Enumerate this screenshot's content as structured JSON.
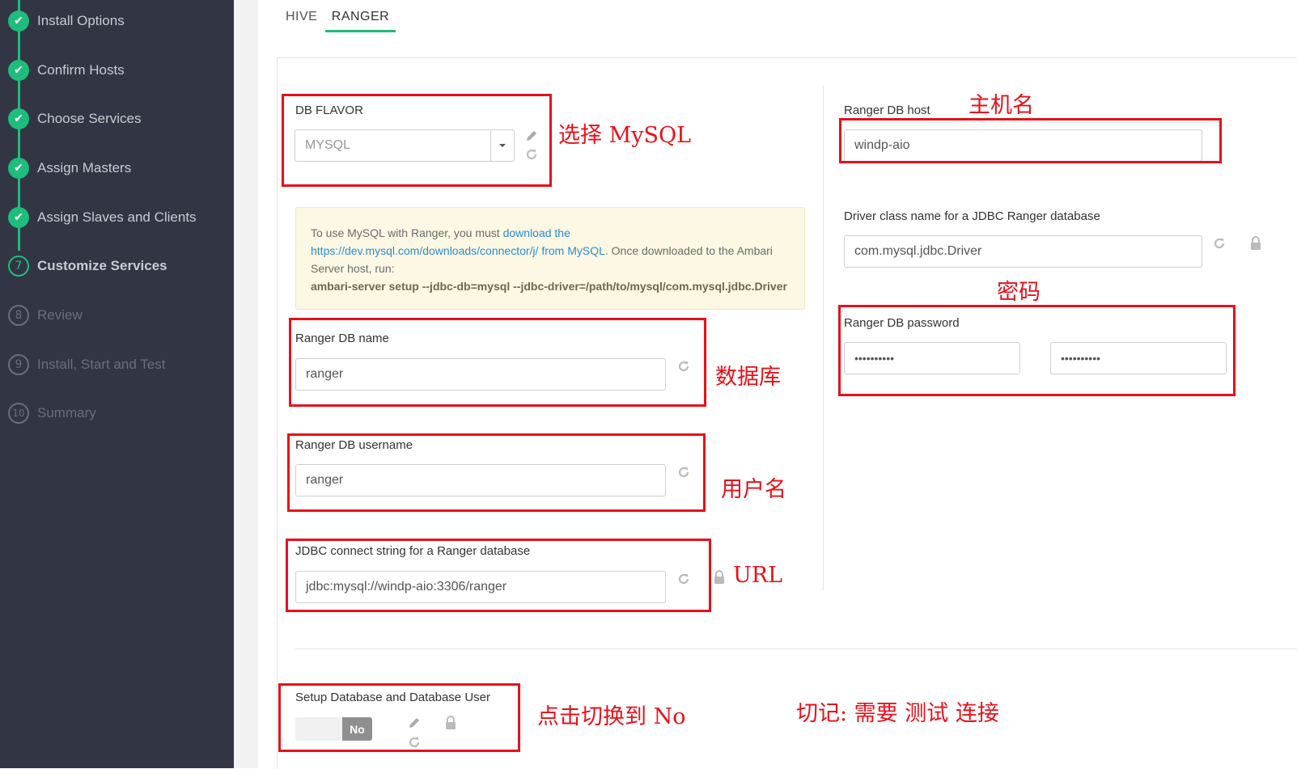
{
  "wizard": {
    "steps": [
      {
        "marker": "✔",
        "label": "Install Options",
        "state": "done"
      },
      {
        "marker": "✔",
        "label": "Confirm Hosts",
        "state": "done"
      },
      {
        "marker": "✔",
        "label": "Choose Services",
        "state": "done"
      },
      {
        "marker": "✔",
        "label": "Assign Masters",
        "state": "done"
      },
      {
        "marker": "✔",
        "label": "Assign Slaves and Clients",
        "state": "done"
      },
      {
        "marker": "7",
        "label": "Customize Services",
        "state": "current"
      },
      {
        "marker": "8",
        "label": "Review",
        "state": "todo"
      },
      {
        "marker": "9",
        "label": "Install, Start and Test",
        "state": "todo"
      },
      {
        "marker": "10",
        "label": "Summary",
        "state": "todo"
      }
    ]
  },
  "tabs": [
    {
      "label": "HIVE",
      "active": false
    },
    {
      "label": "RANGER",
      "active": true
    }
  ],
  "form": {
    "db_flavor": {
      "label": "DB FLAVOR",
      "value": "MYSQL"
    },
    "notice": {
      "text1": "To use MySQL with Ranger, you must ",
      "link1": "download the",
      "link2": "https://dev.mysql.com/downloads/connector/j/ from MySQL",
      "text2": ". Once downloaded to the Ambari Server host, run:",
      "command": "ambari-server setup --jdbc-db=mysql --jdbc-driver=/path/to/mysql/com.mysql.jdbc.Driver"
    },
    "db_name": {
      "label": "Ranger DB name",
      "value": "ranger"
    },
    "db_username": {
      "label": "Ranger DB username",
      "value": "ranger"
    },
    "jdbc_url": {
      "label": "JDBC connect string for a Ranger database",
      "value": "jdbc:mysql://windp-aio:3306/ranger"
    },
    "db_host": {
      "label": "Ranger DB host",
      "value": "windp-aio"
    },
    "driver_class": {
      "label": "Driver class name for a JDBC Ranger database",
      "value": "com.mysql.jdbc.Driver"
    },
    "db_password": {
      "label": "Ranger DB password",
      "value": "••••••••••",
      "confirm": "••••••••••"
    },
    "setup_db": {
      "label": "Setup Database and Database User",
      "toggle": "No"
    }
  },
  "annotations": {
    "select_mysql": "选择 MySQL",
    "hostname": "主机名",
    "password": "密码",
    "database": "数据库",
    "username": "用户名",
    "url": "URL",
    "switch_no": "点击切换到 No",
    "reminder": "切记:  需要 测试 连接"
  },
  "colors": {
    "sidebar_bg": "#323544",
    "accent_green": "#1ebd7c",
    "annotation_red": "#e8101a",
    "notice_bg": "#fcf8e3",
    "link_blue": "#2a8bd1"
  }
}
